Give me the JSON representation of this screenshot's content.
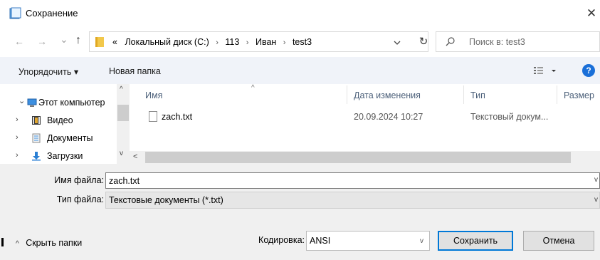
{
  "window": {
    "title": "Сохранение",
    "close_glyph": "✕"
  },
  "nav": {
    "back_glyph": "←",
    "forward_glyph": "→",
    "recent_glyph": "⌄",
    "up_glyph": "↑",
    "breadcrumb": {
      "overflow": "«",
      "items": [
        "Локальный диск (C:)",
        "113",
        "Иван",
        "test3"
      ],
      "separator": "›"
    },
    "refresh_glyph": "↻",
    "search_placeholder": "Поиск в: test3"
  },
  "toolbar": {
    "organize_label": "Упорядочить ▾",
    "new_folder_label": "Новая папка",
    "help_glyph": "?"
  },
  "tree": {
    "items": [
      {
        "label": "Этот компьютер",
        "expander": "⌄",
        "icon": "computer-icon"
      },
      {
        "label": "Видео",
        "expander": "›",
        "icon": "video-folder-icon"
      },
      {
        "label": "Документы",
        "expander": "›",
        "icon": "documents-folder-icon"
      },
      {
        "label": "Загрузки",
        "expander": "›",
        "icon": "downloads-folder-icon"
      }
    ]
  },
  "files": {
    "columns": [
      "Имя",
      "Дата изменения",
      "Тип",
      "Размер"
    ],
    "rows": [
      {
        "name": "zach.txt",
        "modified": "20.09.2024 10:27",
        "type": "Текстовый докум..."
      }
    ]
  },
  "form": {
    "filename_label": "Имя файла:",
    "filename_value": "zach.txt",
    "filetype_label": "Тип файла:",
    "filetype_value": "Текстовые документы (*.txt)",
    "encoding_label": "Кодировка:",
    "encoding_value": "ANSI",
    "hide_folders_label": "Скрыть папки",
    "save_label": "Сохранить",
    "cancel_label": "Отмена"
  },
  "colors": {
    "accent": "#0078d7",
    "help": "#1a6fd8",
    "toolbar_bg": "#f0f3f9",
    "header_text": "#4c607a"
  }
}
